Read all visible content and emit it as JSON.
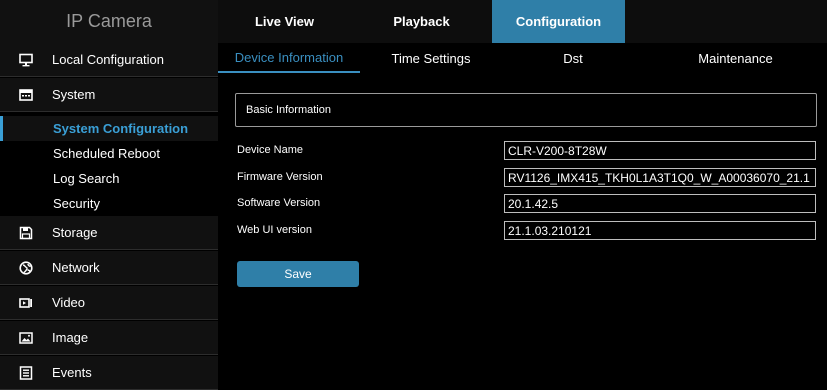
{
  "header": {
    "brand": "IP Camera",
    "tabs": [
      {
        "label": "Live View"
      },
      {
        "label": "Playback"
      },
      {
        "label": "Configuration"
      }
    ]
  },
  "sidebar": {
    "items": [
      {
        "label": "Local Configuration",
        "icon": "monitor-icon"
      },
      {
        "label": "System",
        "icon": "keyboard-icon"
      },
      {
        "label": "Storage",
        "icon": "floppy-disk-icon"
      },
      {
        "label": "Network",
        "icon": "globe-icon"
      },
      {
        "label": "Video",
        "icon": "video-icon"
      },
      {
        "label": "Image",
        "icon": "image-icon"
      },
      {
        "label": "Events",
        "icon": "events-icon"
      }
    ],
    "system_submenu": [
      {
        "label": "System Configuration"
      },
      {
        "label": "Scheduled Reboot"
      },
      {
        "label": "Log Search"
      },
      {
        "label": "Security"
      }
    ]
  },
  "subtabs": [
    {
      "label": "Device Information"
    },
    {
      "label": "Time Settings"
    },
    {
      "label": "Dst"
    },
    {
      "label": "Maintenance"
    }
  ],
  "main": {
    "section_title": "Basic Information",
    "fields": [
      {
        "label": "Device Name",
        "value": "CLR-V200-8T28W"
      },
      {
        "label": "Firmware Version",
        "value": "RV1126_IMX415_TKH0L1A3T1Q0_W_A00036070_21.1"
      },
      {
        "label": "Software Version",
        "value": "20.1.42.5"
      },
      {
        "label": "Web UI version",
        "value": "21.1.03.210121"
      }
    ],
    "save_label": "Save"
  },
  "colors": {
    "accent": "#2f7fa8",
    "active_text": "#3a9fd6",
    "background": "#000000"
  }
}
